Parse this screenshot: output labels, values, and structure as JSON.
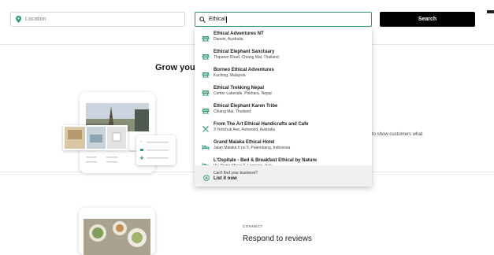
{
  "search": {
    "location_placeholder": "Location",
    "query_value": "Ethical",
    "search_button_label": "Search"
  },
  "content": {
    "section1_heading": "Grow your b",
    "section1_description": "to show customers what",
    "connect_label": "CONNECT",
    "respond_heading": "Respond to reviews"
  },
  "suggestions": [
    {
      "icon": "attraction-icon",
      "title": "Ethical Adventures NT",
      "subtitle": "Darwin, Australia"
    },
    {
      "icon": "attraction-icon",
      "title": "Ethical Elephant Sanctuary",
      "subtitle": "Thipanet Road, Chiang Mai, Thailand"
    },
    {
      "icon": "attraction-icon",
      "title": "Borneo Ethical Adventures",
      "subtitle": "Kuching, Malaysia"
    },
    {
      "icon": "attraction-icon",
      "title": "Ethical Trekking Nepal",
      "subtitle": "Center Lakeside, Pokhara, Nepal"
    },
    {
      "icon": "attraction-icon",
      "title": "Ethical Elephant Karen Tribe",
      "subtitle": "Chiang Mai, Thailand"
    },
    {
      "icon": "restaurant-icon",
      "title": "From The Art Ethical Handicrafts and Cafe",
      "subtitle": "3 Yertchuk Ave, Ashwood, Australia"
    },
    {
      "icon": "hotel-icon",
      "title": "Grand Malaka Ethical Hotel",
      "subtitle": "Jalan Malaka II no 5, Palembang, Indonesia"
    },
    {
      "icon": "hotel-icon",
      "title": "L'Ospitale - Bed & Breakfast Ethical by Nature",
      "subtitle": "Via Pietro Micca 3, Legnano, Italy"
    }
  ],
  "footer": {
    "question": "Can't find your business?",
    "link": "List it now"
  },
  "colors": {
    "accent": "#2e9b6b",
    "button": "#000000"
  }
}
